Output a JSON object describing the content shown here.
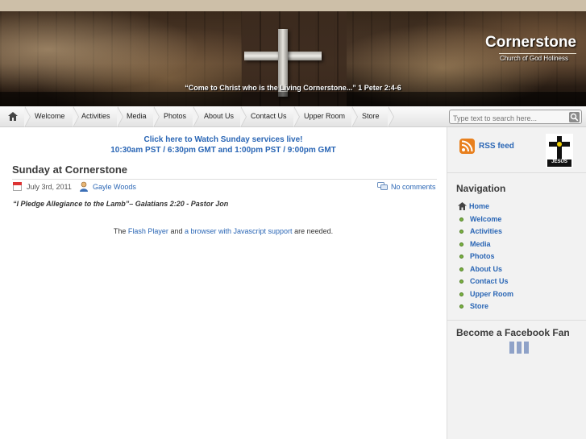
{
  "header": {
    "site_title": "Cornerstone",
    "site_tagline": "Church of God Holiness",
    "verse": "“Come to Christ who is the Living Cornerstone...” 1 Peter 2:4-6"
  },
  "navbar": {
    "items": [
      "Welcome",
      "Activities",
      "Media",
      "Photos",
      "About Us",
      "Contact Us",
      "Upper Room",
      "Store"
    ],
    "search_placeholder": "Type text to search here..."
  },
  "main": {
    "announcement_line1": "Click here to Watch Sunday services live!",
    "announcement_line2": "10:30am PST / 6:30pm GMT and 1:00pm PST / 9:00pm GMT",
    "post": {
      "title": "Sunday at Cornerstone",
      "date": "July 3rd, 2011",
      "author": "Gayle Woods",
      "comments": "No comments",
      "quote": "“I Pledge Allegiance to the Lamb”– Galatians 2:20 - Pastor Jon"
    },
    "flash_message": {
      "prefix": "The",
      "link1": "Flash Player",
      "middle": "and",
      "link2": "a browser with Javascript support",
      "suffix": "are needed."
    }
  },
  "sidebar": {
    "rss_label": "RSS feed",
    "logo_text": "JESUS",
    "navigation_heading": "Navigation",
    "nav_links": [
      "Home",
      "Welcome",
      "Activities",
      "Media",
      "Photos",
      "About Us",
      "Contact Us",
      "Upper Room",
      "Store"
    ],
    "facebook_heading": "Become a Facebook Fan"
  },
  "colors": {
    "link": "#2a66b5",
    "heading": "#3b3b3b",
    "rss_orange": "#e36f0f",
    "bullet_green": "#7cb342"
  },
  "icons": [
    "home-icon",
    "search-icon",
    "calendar-icon",
    "author-icon",
    "comments-icon",
    "rss-icon"
  ]
}
